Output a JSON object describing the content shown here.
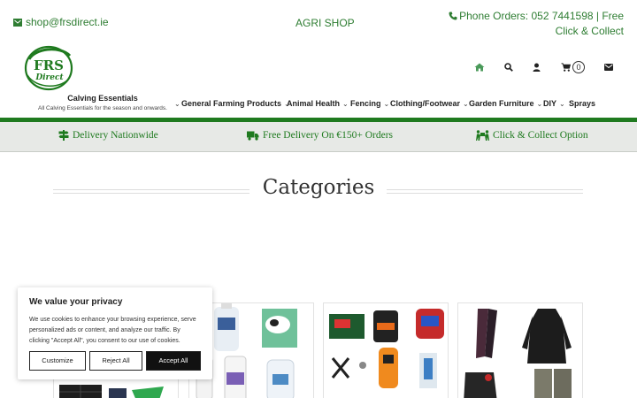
{
  "topbar": {
    "email": "shop@frsdirect.ie",
    "center": "AGRI SHOP",
    "phone": "Phone Orders: 052 7441598 | Free Click & Collect"
  },
  "logo": {
    "line1": "FRS",
    "line2": "Direct"
  },
  "header_icons": {
    "items": [
      "home-icon",
      "search-icon",
      "user-icon",
      "cart-icon",
      "envelope-icon"
    ],
    "cart_count": "0"
  },
  "nav": {
    "calving_title": "Calving Essentials",
    "calving_subtitle": "All Calving Essentials for the season and onwards.",
    "items": [
      {
        "label": "General Farming Products",
        "dropdown": true
      },
      {
        "label": "Animal Health",
        "dropdown": true
      },
      {
        "label": "Fencing",
        "dropdown": true
      },
      {
        "label": "Clothing/Footwear",
        "dropdown": true
      },
      {
        "label": "Garden Furniture",
        "dropdown": true
      },
      {
        "label": "DIY",
        "dropdown": true
      },
      {
        "label": "Sprays",
        "dropdown": false
      }
    ]
  },
  "features": [
    {
      "icon": "signpost-icon",
      "label": "Delivery Nationwide"
    },
    {
      "icon": "truck-icon",
      "label": "Free Delivery On €150+ Orders"
    },
    {
      "icon": "people-carry-icon",
      "label": "Click & Collect Option"
    }
  ],
  "categories": {
    "heading": "Categories"
  },
  "cookie": {
    "title": "We value your privacy",
    "body": "We use cookies to enhance your browsing experience, serve personalized ads or content, and analyze our traffic. By clicking \"Accept All\", you consent to our use of cookies.",
    "customize": "Customize",
    "reject": "Reject All",
    "accept": "Accept All"
  },
  "colors": {
    "brand_green": "#1f7a1f",
    "link_green": "#2e7d32",
    "band_grey": "#e7e9e6"
  }
}
